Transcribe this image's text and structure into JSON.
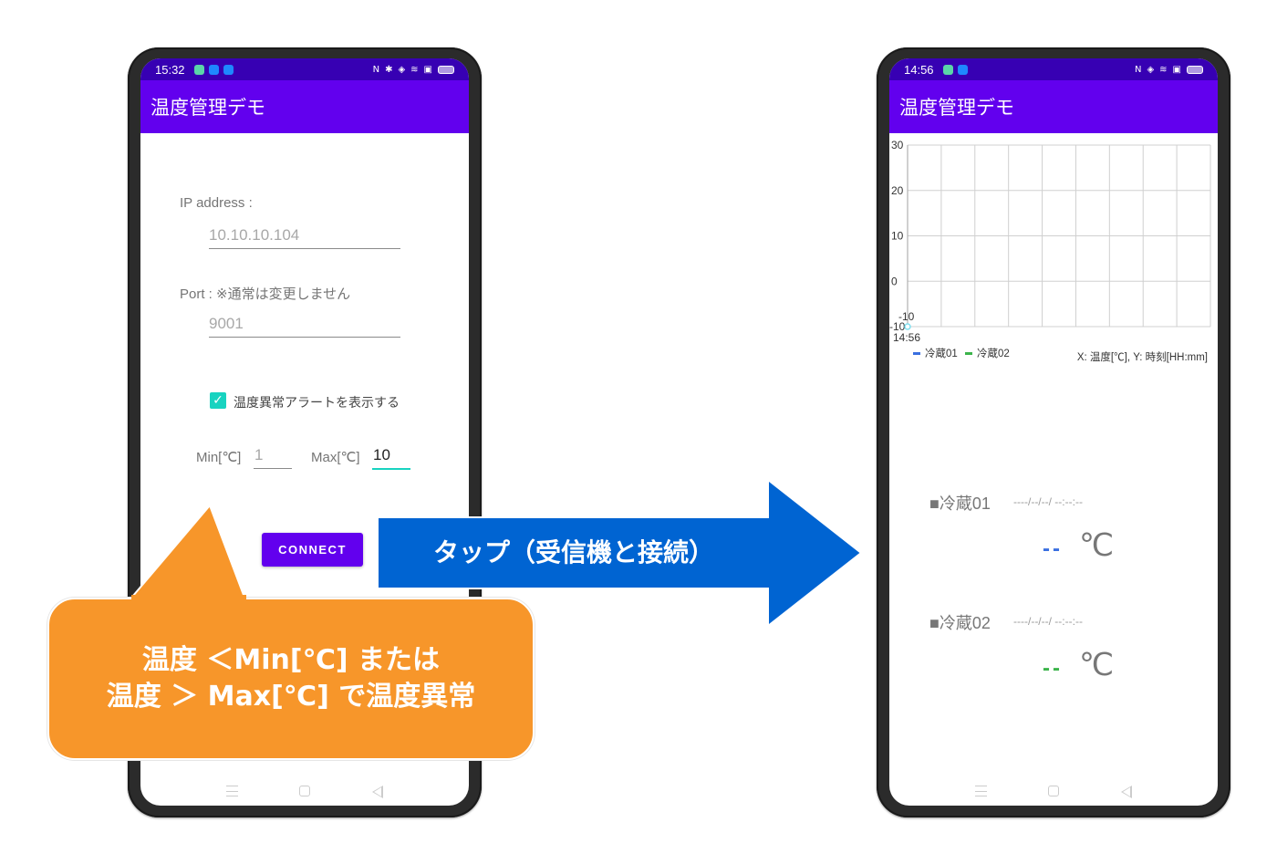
{
  "left_phone": {
    "status_bar": {
      "time": "15:32",
      "app_icons": [
        "green-app-icon",
        "blue-app-icon",
        "blue-app-icon"
      ],
      "right_icons": [
        "nfc-icon",
        "bluetooth-icon",
        "vibrate-icon",
        "wifi-icon",
        "cast-icon",
        "battery-icon"
      ]
    },
    "app_title": "温度管理デモ",
    "form": {
      "ip_label": "IP address :",
      "ip_value": "10.10.10.104",
      "port_label": "Port : ※通常は変更しません",
      "port_value": "9001",
      "alert_checkbox_label": "温度異常アラートを表示する",
      "alert_checked": true,
      "min_label": "Min[℃]",
      "min_value": "1",
      "max_label": "Max[℃]",
      "max_value": "10",
      "connect_label": "CONNECT"
    }
  },
  "right_phone": {
    "status_bar": {
      "time": "14:56",
      "app_icons": [
        "green-app-icon",
        "blue-app-icon"
      ],
      "right_icons": [
        "nfc-icon",
        "vibrate-icon",
        "wifi-icon",
        "cast-icon",
        "battery-icon"
      ]
    },
    "app_title": "温度管理デモ",
    "axis_caption": "X: 温度[℃], Y: 時刻[HH:mm]",
    "sensors": [
      {
        "name": "■冷蔵01",
        "timestamp": "----/--/--/ --:--:--",
        "value": "--",
        "unit": "℃",
        "color": "#3a6fe0"
      },
      {
        "name": "■冷蔵02",
        "timestamp": "----/--/--/ --:--:--",
        "value": "--",
        "unit": "℃",
        "color": "#3cb44b"
      }
    ]
  },
  "chart_data": {
    "type": "line",
    "title": "",
    "xlabel": "時刻[HH:mm]",
    "ylabel": "温度[℃]",
    "ylim": [
      -10,
      30
    ],
    "yticks": [
      "30",
      "20",
      "10",
      "0",
      "-10"
    ],
    "x_tick_labels": [
      "14:56"
    ],
    "grid": true,
    "x_divisions": 9,
    "legend": {
      "placement": "bottom-left",
      "entries": [
        {
          "name": "冷蔵01",
          "color": "#3a6fe0"
        },
        {
          "name": "冷蔵02",
          "color": "#3cb44b"
        }
      ]
    },
    "series": [
      {
        "name": "冷蔵01",
        "values": []
      },
      {
        "name": "冷蔵02",
        "values": []
      }
    ],
    "annotations": [
      {
        "x": "14:56",
        "y": -10,
        "label": "-10",
        "marker": "hollow-circle",
        "color": "#7fe0f0"
      }
    ]
  },
  "annotations": {
    "callout_lines": [
      "温度 ＜Min[℃] または",
      "温度 ＞ Max[℃] で温度異常"
    ],
    "arrow_label": "タップ（受信機と接続）",
    "callout_color": "#f7962a",
    "arrow_color": "#0064d2"
  }
}
